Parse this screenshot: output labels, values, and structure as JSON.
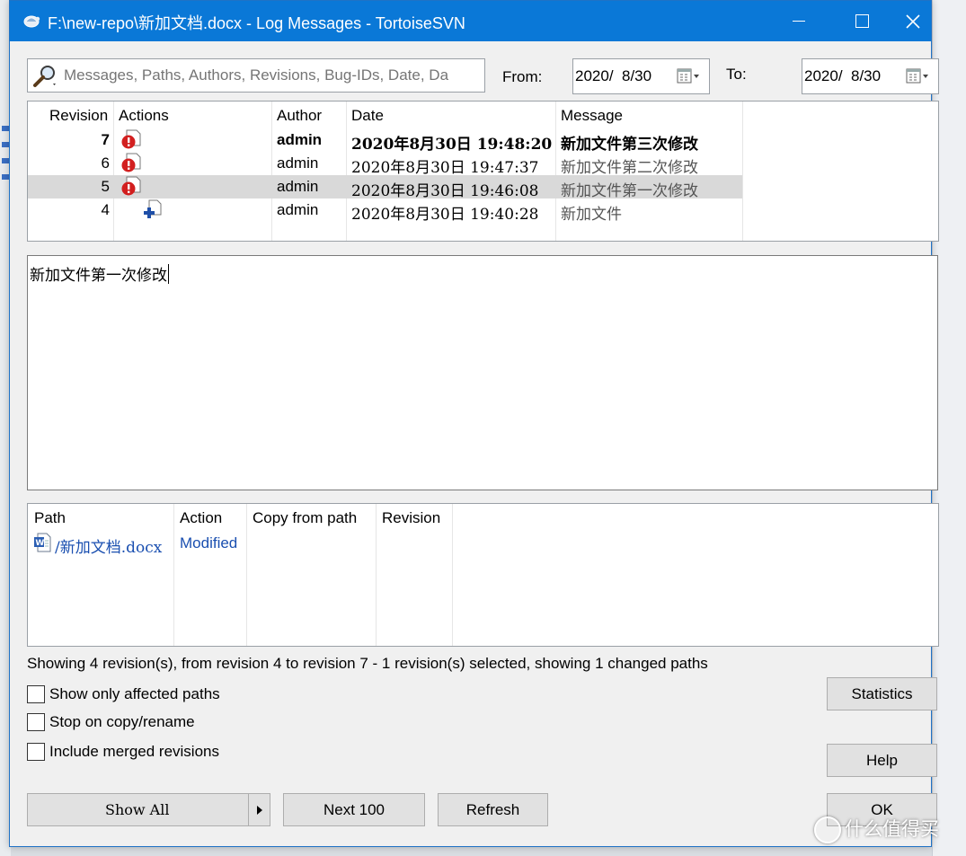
{
  "window": {
    "title": "F:\\new-repo\\新加文档.docx - Log Messages - TortoiseSVN"
  },
  "filter": {
    "placeholder": "Messages, Paths, Authors, Revisions, Bug-IDs, Date, Da",
    "from_label": "From:",
    "from_value": "2020/  8/30",
    "to_label": "To:",
    "to_value": "2020/  8/30"
  },
  "revisions": {
    "headers": {
      "revision": "Revision",
      "actions": "Actions",
      "author": "Author",
      "date": "Date",
      "message": "Message"
    },
    "rows": [
      {
        "revision": "7",
        "action_icon": "modified-icon",
        "author": "admin",
        "date": "2020年8月30日 19:48:20",
        "message": "新加文件第三次修改",
        "bold": true,
        "selected": false
      },
      {
        "revision": "6",
        "action_icon": "modified-icon",
        "author": "admin",
        "date": "2020年8月30日 19:47:37",
        "message": "新加文件第二次修改",
        "bold": false,
        "selected": false
      },
      {
        "revision": "5",
        "action_icon": "modified-icon",
        "author": "admin",
        "date": "2020年8月30日 19:46:08",
        "message": "新加文件第一次修改",
        "bold": false,
        "selected": true
      },
      {
        "revision": "4",
        "action_icon": "added-icon",
        "author": "admin",
        "date": "2020年8月30日 19:40:28",
        "message": "新加文件",
        "bold": false,
        "selected": false
      }
    ]
  },
  "message_detail": {
    "text": "新加文件第一次修改"
  },
  "paths": {
    "headers": {
      "path": "Path",
      "action": "Action",
      "copy_from_path": "Copy from path",
      "revision": "Revision"
    },
    "rows": [
      {
        "icon": "word-document-icon",
        "path": "/新加文档.docx",
        "action": "Modified",
        "copy_from_path": "",
        "revision": ""
      }
    ]
  },
  "status_text": "Showing 4 revision(s), from revision 4 to revision 7 - 1 revision(s) selected, showing 1 changed paths",
  "options": {
    "show_only_affected": {
      "label": "Show only affected paths",
      "checked": false
    },
    "stop_on_copy": {
      "label": "Stop on copy/rename",
      "checked": false
    },
    "include_merged": {
      "label": "Include merged revisions",
      "checked": false
    }
  },
  "buttons": {
    "statistics": "Statistics",
    "help": "Help",
    "show_all": "Show All",
    "next_100": "Next 100",
    "refresh": "Refresh",
    "ok": "OK"
  },
  "watermark": "什么值得买",
  "colors": {
    "titlebar": "#0a78d7",
    "selection": "#d9d9d9",
    "modified_red": "#d21f1f",
    "link_blue": "#1a4fb0"
  }
}
